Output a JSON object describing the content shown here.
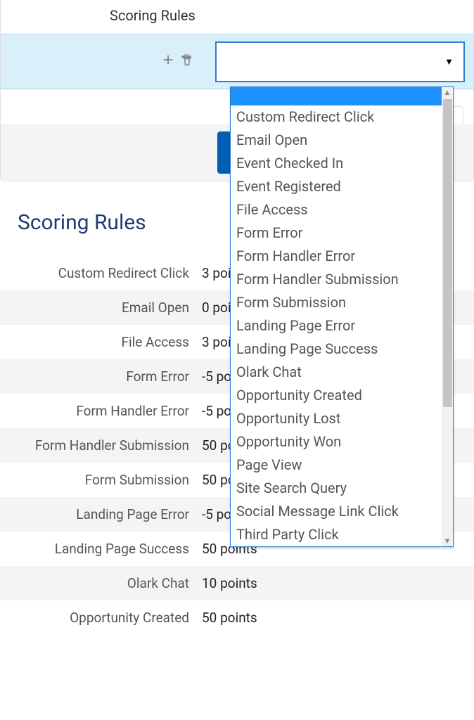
{
  "editor": {
    "header": "Scoring Rules",
    "dropdown": {
      "selected": "",
      "options": [
        "",
        "Custom Redirect Click",
        "Email Open",
        "Event Checked In",
        "Event Registered",
        "File Access",
        "Form Error",
        "Form Handler Error",
        "Form Handler Submission",
        "Form Submission",
        "Landing Page Error",
        "Landing Page Success",
        "Olark Chat",
        "Opportunity Created",
        "Opportunity Lost",
        "Opportunity Won",
        "Page View",
        "Site Search Query",
        "Social Message Link Click",
        "Third Party Click"
      ]
    }
  },
  "section": {
    "title": "Scoring Rules"
  },
  "rules": [
    {
      "label": "Custom Redirect Click",
      "value": "3 points"
    },
    {
      "label": "Email Open",
      "value": "0 points"
    },
    {
      "label": "File Access",
      "value": "3 points"
    },
    {
      "label": "Form Error",
      "value": "-5 points"
    },
    {
      "label": "Form Handler Error",
      "value": "-5 points"
    },
    {
      "label": "Form Handler Submission",
      "value": "50 points"
    },
    {
      "label": "Form Submission",
      "value": "50 points"
    },
    {
      "label": "Landing Page Error",
      "value": "-5 points"
    },
    {
      "label": "Landing Page Success",
      "value": "50 points"
    },
    {
      "label": "Olark Chat",
      "value": "10 points"
    },
    {
      "label": "Opportunity Created",
      "value": "50 points"
    }
  ]
}
